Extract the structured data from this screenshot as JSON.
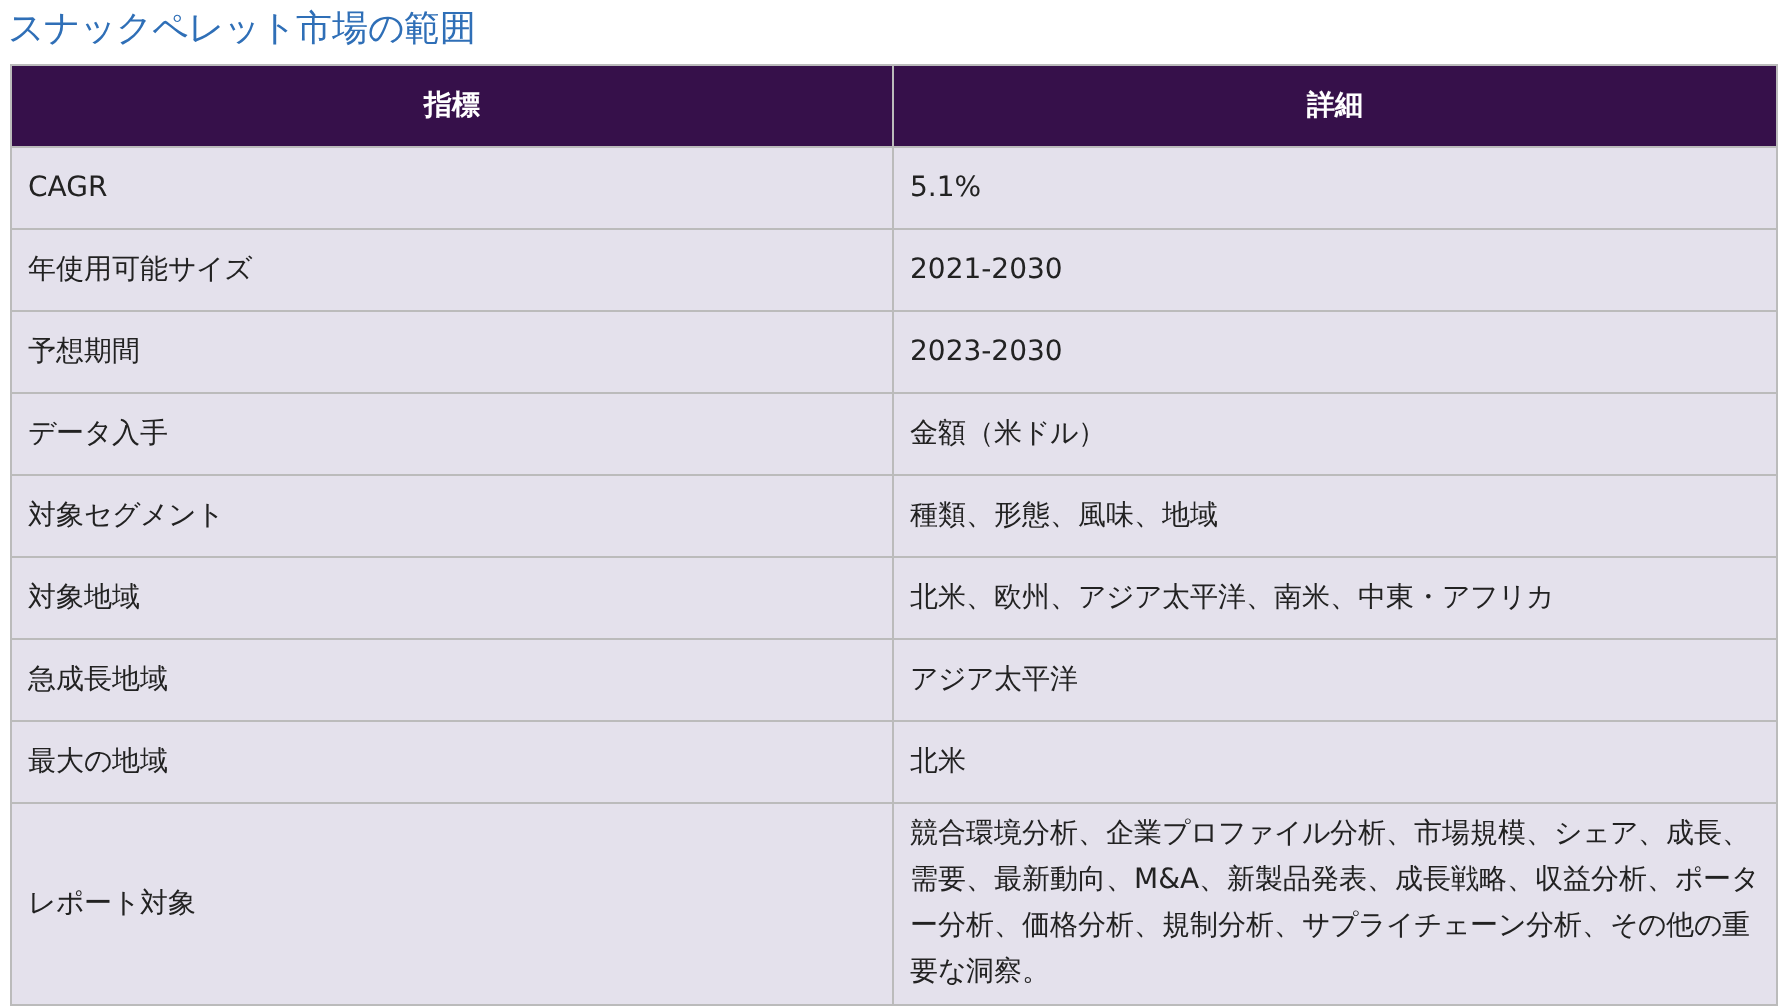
{
  "title": "スナックペレット市場の範囲",
  "table": {
    "columns": [
      "指標",
      "詳細"
    ],
    "rows": [
      {
        "metric": "CAGR",
        "detail": "5.1%"
      },
      {
        "metric": "年使用可能サイズ",
        "detail": "2021-2030"
      },
      {
        "metric": "予想期間",
        "detail": "2023-2030"
      },
      {
        "metric": "データ入手",
        "detail": "金額（米ドル）"
      },
      {
        "metric": "対象セグメント",
        "detail": "種類、形態、風味、地域"
      },
      {
        "metric": "対象地域",
        "detail": "北米、欧州、アジア太平洋、南米、中東・アフリカ"
      },
      {
        "metric": "急成長地域",
        "detail": "アジア太平洋"
      },
      {
        "metric": "最大の地域",
        "detail": "北米"
      },
      {
        "metric": "レポート対象",
        "detail": "競合環境分析、企業プロファイル分析、市場規模、シェア、成長、需要、最新動向、M&A、新製品発表、成長戦略、収益分析、ポーター分析、価格分析、規制分析、サプライチェーン分析、その他の重要な洞察。"
      }
    ]
  }
}
